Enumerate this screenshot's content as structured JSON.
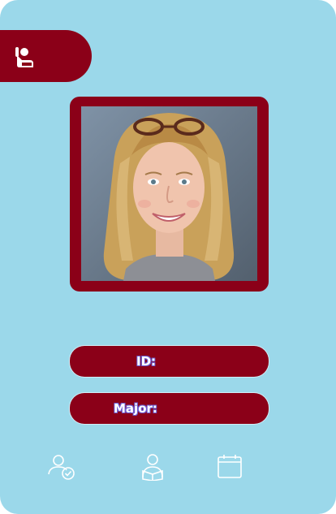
{
  "header": {
    "icon": "student-raised-hand-icon"
  },
  "photo": {
    "alt": ""
  },
  "fields": {
    "id_label": "ID:",
    "id_value": "",
    "major_label": "Major:",
    "major_value": ""
  },
  "bottom_nav": {
    "items": [
      {
        "icon": "user-check-icon"
      },
      {
        "icon": "student-reading-icon"
      },
      {
        "icon": "calendar-icon"
      }
    ]
  },
  "colors": {
    "background": "#9bd8ea",
    "accent": "#8b0018",
    "text": "#ffffff"
  }
}
